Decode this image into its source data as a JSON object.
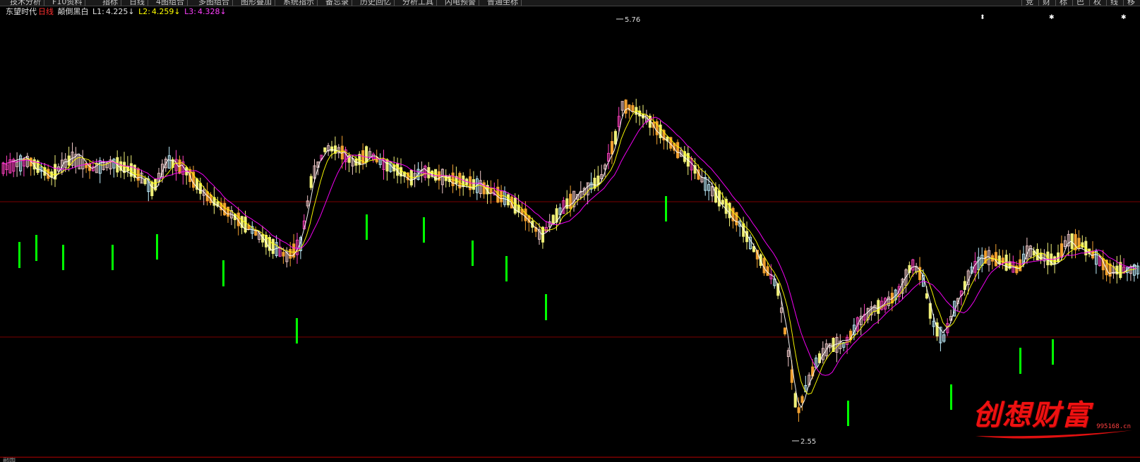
{
  "toolbar": {
    "buttons": [
      "技术分析",
      "F10资料",
      "指标",
      "日线",
      "4图组合",
      "多图组合",
      "图形叠加",
      "系统指示",
      "备忘录",
      "历史回忆",
      "分析工具",
      "闪电预警",
      "普通坐标"
    ],
    "right_buttons": [
      "竞",
      "财",
      "标",
      "巴",
      "权",
      "线",
      "移"
    ]
  },
  "legend": {
    "stock_name": "东望时代",
    "period": "日线",
    "indicator": "颠倒黑白",
    "l1_label": "L1:",
    "l1_value": "4.225↓",
    "l2_label": "L2:",
    "l2_value": "4.259↓",
    "l3_label": "L3:",
    "l3_value": "4.328↓"
  },
  "chart_data": {
    "type": "candlestick",
    "title": "东望时代 日线",
    "price_high_label": "5.76",
    "price_low_label": "2.55",
    "series_colors": {
      "L1": "#ffffff",
      "L2": "#ffff00",
      "L3": "#ff00ff",
      "signal": "#00ff00"
    },
    "bottom_label_left": "副图"
  },
  "watermark": {
    "text": "创想财富",
    "url": "995168.cn"
  },
  "colors": {
    "background": "#000000",
    "grid": "#7a0000",
    "up_pale": "#f0c8c8",
    "up_pink": "#ff40c0",
    "up_cyan": "#c0f0ff",
    "down_yellow": "#f0f078",
    "down_orange": "#f0a030"
  }
}
